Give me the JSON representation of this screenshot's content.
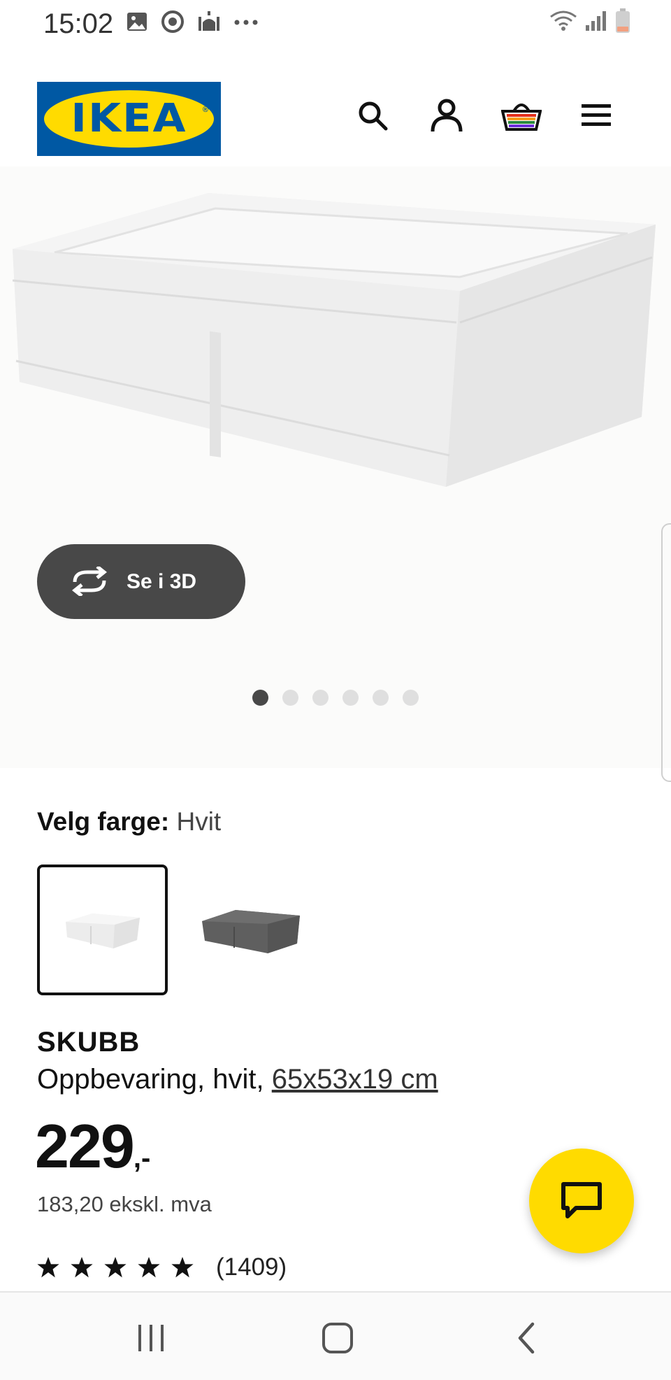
{
  "status_bar": {
    "time": "15:02",
    "left_icons": [
      "image-icon",
      "sync-icon",
      "mosque-icon",
      "more-icon"
    ],
    "right_icons": [
      "wifi-icon",
      "signal-icon",
      "battery-icon"
    ]
  },
  "header": {
    "logo_text": "IKEA",
    "logo_colors": {
      "blue": "#0058a3",
      "yellow": "#ffdb00"
    },
    "icons": [
      "search-icon",
      "account-icon",
      "basket-icon",
      "menu-icon"
    ]
  },
  "hero": {
    "view_3d_label": "Se i 3D",
    "carousel": {
      "count": 6,
      "active": 1
    }
  },
  "color_selector": {
    "label": "Velg farge:",
    "value": "Hvit",
    "options": [
      "white",
      "dark grey"
    ],
    "selected": "white"
  },
  "product": {
    "name": "SKUBB",
    "description": "Oppbevaring, hvit, ",
    "size": "65x53x19 cm",
    "price": "229",
    "price_suffix": ",-",
    "price_ex_vat": "183,20 ekskl. mva",
    "rating_stars": 5,
    "review_count": "(1409)"
  },
  "chat": {
    "icon": "chat-icon",
    "color": "#ffdb00"
  },
  "nav_bar": {
    "buttons": [
      "recents-icon",
      "home-icon",
      "back-icon"
    ]
  }
}
